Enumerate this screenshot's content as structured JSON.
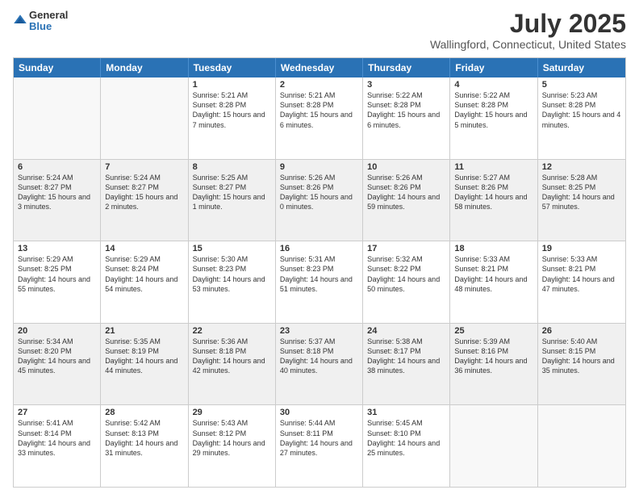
{
  "header": {
    "logo_line1": "General",
    "logo_line2": "Blue",
    "title": "July 2025",
    "subtitle": "Wallingford, Connecticut, United States"
  },
  "days_of_week": [
    "Sunday",
    "Monday",
    "Tuesday",
    "Wednesday",
    "Thursday",
    "Friday",
    "Saturday"
  ],
  "weeks": [
    [
      {
        "day": "",
        "sunrise": "",
        "sunset": "",
        "daylight": ""
      },
      {
        "day": "",
        "sunrise": "",
        "sunset": "",
        "daylight": ""
      },
      {
        "day": "1",
        "sunrise": "Sunrise: 5:21 AM",
        "sunset": "Sunset: 8:28 PM",
        "daylight": "Daylight: 15 hours and 7 minutes."
      },
      {
        "day": "2",
        "sunrise": "Sunrise: 5:21 AM",
        "sunset": "Sunset: 8:28 PM",
        "daylight": "Daylight: 15 hours and 6 minutes."
      },
      {
        "day": "3",
        "sunrise": "Sunrise: 5:22 AM",
        "sunset": "Sunset: 8:28 PM",
        "daylight": "Daylight: 15 hours and 6 minutes."
      },
      {
        "day": "4",
        "sunrise": "Sunrise: 5:22 AM",
        "sunset": "Sunset: 8:28 PM",
        "daylight": "Daylight: 15 hours and 5 minutes."
      },
      {
        "day": "5",
        "sunrise": "Sunrise: 5:23 AM",
        "sunset": "Sunset: 8:28 PM",
        "daylight": "Daylight: 15 hours and 4 minutes."
      }
    ],
    [
      {
        "day": "6",
        "sunrise": "Sunrise: 5:24 AM",
        "sunset": "Sunset: 8:27 PM",
        "daylight": "Daylight: 15 hours and 3 minutes."
      },
      {
        "day": "7",
        "sunrise": "Sunrise: 5:24 AM",
        "sunset": "Sunset: 8:27 PM",
        "daylight": "Daylight: 15 hours and 2 minutes."
      },
      {
        "day": "8",
        "sunrise": "Sunrise: 5:25 AM",
        "sunset": "Sunset: 8:27 PM",
        "daylight": "Daylight: 15 hours and 1 minute."
      },
      {
        "day": "9",
        "sunrise": "Sunrise: 5:26 AM",
        "sunset": "Sunset: 8:26 PM",
        "daylight": "Daylight: 15 hours and 0 minutes."
      },
      {
        "day": "10",
        "sunrise": "Sunrise: 5:26 AM",
        "sunset": "Sunset: 8:26 PM",
        "daylight": "Daylight: 14 hours and 59 minutes."
      },
      {
        "day": "11",
        "sunrise": "Sunrise: 5:27 AM",
        "sunset": "Sunset: 8:26 PM",
        "daylight": "Daylight: 14 hours and 58 minutes."
      },
      {
        "day": "12",
        "sunrise": "Sunrise: 5:28 AM",
        "sunset": "Sunset: 8:25 PM",
        "daylight": "Daylight: 14 hours and 57 minutes."
      }
    ],
    [
      {
        "day": "13",
        "sunrise": "Sunrise: 5:29 AM",
        "sunset": "Sunset: 8:25 PM",
        "daylight": "Daylight: 14 hours and 55 minutes."
      },
      {
        "day": "14",
        "sunrise": "Sunrise: 5:29 AM",
        "sunset": "Sunset: 8:24 PM",
        "daylight": "Daylight: 14 hours and 54 minutes."
      },
      {
        "day": "15",
        "sunrise": "Sunrise: 5:30 AM",
        "sunset": "Sunset: 8:23 PM",
        "daylight": "Daylight: 14 hours and 53 minutes."
      },
      {
        "day": "16",
        "sunrise": "Sunrise: 5:31 AM",
        "sunset": "Sunset: 8:23 PM",
        "daylight": "Daylight: 14 hours and 51 minutes."
      },
      {
        "day": "17",
        "sunrise": "Sunrise: 5:32 AM",
        "sunset": "Sunset: 8:22 PM",
        "daylight": "Daylight: 14 hours and 50 minutes."
      },
      {
        "day": "18",
        "sunrise": "Sunrise: 5:33 AM",
        "sunset": "Sunset: 8:21 PM",
        "daylight": "Daylight: 14 hours and 48 minutes."
      },
      {
        "day": "19",
        "sunrise": "Sunrise: 5:33 AM",
        "sunset": "Sunset: 8:21 PM",
        "daylight": "Daylight: 14 hours and 47 minutes."
      }
    ],
    [
      {
        "day": "20",
        "sunrise": "Sunrise: 5:34 AM",
        "sunset": "Sunset: 8:20 PM",
        "daylight": "Daylight: 14 hours and 45 minutes."
      },
      {
        "day": "21",
        "sunrise": "Sunrise: 5:35 AM",
        "sunset": "Sunset: 8:19 PM",
        "daylight": "Daylight: 14 hours and 44 minutes."
      },
      {
        "day": "22",
        "sunrise": "Sunrise: 5:36 AM",
        "sunset": "Sunset: 8:18 PM",
        "daylight": "Daylight: 14 hours and 42 minutes."
      },
      {
        "day": "23",
        "sunrise": "Sunrise: 5:37 AM",
        "sunset": "Sunset: 8:18 PM",
        "daylight": "Daylight: 14 hours and 40 minutes."
      },
      {
        "day": "24",
        "sunrise": "Sunrise: 5:38 AM",
        "sunset": "Sunset: 8:17 PM",
        "daylight": "Daylight: 14 hours and 38 minutes."
      },
      {
        "day": "25",
        "sunrise": "Sunrise: 5:39 AM",
        "sunset": "Sunset: 8:16 PM",
        "daylight": "Daylight: 14 hours and 36 minutes."
      },
      {
        "day": "26",
        "sunrise": "Sunrise: 5:40 AM",
        "sunset": "Sunset: 8:15 PM",
        "daylight": "Daylight: 14 hours and 35 minutes."
      }
    ],
    [
      {
        "day": "27",
        "sunrise": "Sunrise: 5:41 AM",
        "sunset": "Sunset: 8:14 PM",
        "daylight": "Daylight: 14 hours and 33 minutes."
      },
      {
        "day": "28",
        "sunrise": "Sunrise: 5:42 AM",
        "sunset": "Sunset: 8:13 PM",
        "daylight": "Daylight: 14 hours and 31 minutes."
      },
      {
        "day": "29",
        "sunrise": "Sunrise: 5:43 AM",
        "sunset": "Sunset: 8:12 PM",
        "daylight": "Daylight: 14 hours and 29 minutes."
      },
      {
        "day": "30",
        "sunrise": "Sunrise: 5:44 AM",
        "sunset": "Sunset: 8:11 PM",
        "daylight": "Daylight: 14 hours and 27 minutes."
      },
      {
        "day": "31",
        "sunrise": "Sunrise: 5:45 AM",
        "sunset": "Sunset: 8:10 PM",
        "daylight": "Daylight: 14 hours and 25 minutes."
      },
      {
        "day": "",
        "sunrise": "",
        "sunset": "",
        "daylight": ""
      },
      {
        "day": "",
        "sunrise": "",
        "sunset": "",
        "daylight": ""
      }
    ]
  ],
  "colors": {
    "header_bg": "#2a72b5",
    "header_text": "#ffffff",
    "alt_row_bg": "#f0f0f0",
    "empty_bg": "#f8f8f8"
  }
}
